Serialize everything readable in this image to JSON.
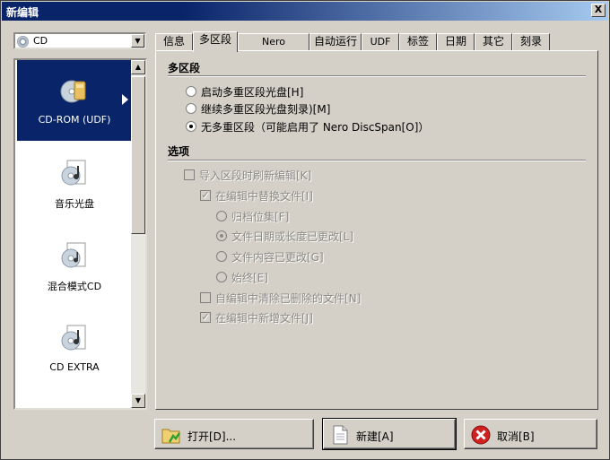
{
  "window": {
    "title": "新编辑",
    "close_label": "X"
  },
  "combo": {
    "value": "CD"
  },
  "list": {
    "items": [
      {
        "label": "CD-ROM (UDF)",
        "icon": "cd-rom-udf-icon",
        "selected": true
      },
      {
        "label": "音乐光盘",
        "icon": "audio-cd-icon"
      },
      {
        "label": "混合模式CD",
        "icon": "mixed-mode-cd-icon"
      },
      {
        "label": "CD EXTRA",
        "icon": "cd-extra-icon"
      }
    ]
  },
  "tabs": [
    "信息",
    "多区段",
    "Nero DiscSpan",
    "自动运行",
    "UDF",
    "标签",
    "日期",
    "其它",
    "刻录"
  ],
  "active_tab": "多区段",
  "multisession": {
    "heading": "多区段",
    "options": [
      {
        "label": "启动多重区段光盘[H]",
        "selected": false
      },
      {
        "label": "继续多重区段光盘刻录)[M]",
        "selected": false
      },
      {
        "label": "无多重区段（可能启用了 Nero DiscSpan[O]）",
        "selected": true
      }
    ]
  },
  "options": {
    "heading": "选项",
    "refresh_on_import": {
      "label": "导入区段时刷新编辑[K]",
      "checked": false
    },
    "replace_files": {
      "label": "在编辑中替换文件[I]",
      "checked": true
    },
    "replace_modes": [
      {
        "label": "归档位集[F]",
        "selected": false
      },
      {
        "label": "文件日期或长度已更改[L]",
        "selected": true
      },
      {
        "label": "文件内容已更改[G]",
        "selected": false
      },
      {
        "label": "始终[E]",
        "selected": false
      }
    ],
    "remove_deleted": {
      "label": "自编辑中清除已删除的文件[N]",
      "checked": false
    },
    "add_new": {
      "label": "在编辑中新增文件[J]",
      "checked": true
    }
  },
  "buttons": {
    "open": "打开[D]...",
    "new": "新建[A]",
    "cancel": "取消[B]"
  }
}
